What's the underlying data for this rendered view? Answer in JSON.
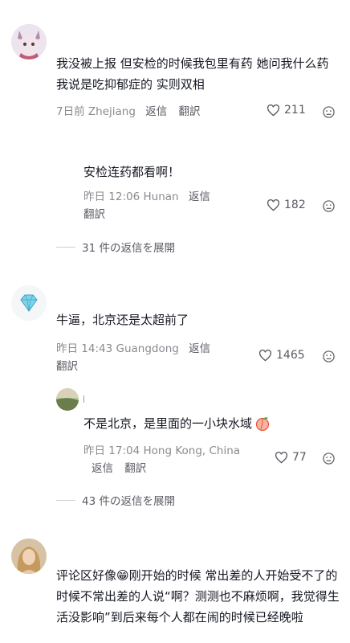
{
  "comments": [
    {
      "text": "我没被上报 但安检的时候我包里有药 她问我什么药 我说是吃抑郁症的 实则双相",
      "time": "7日前",
      "location": "Zhejiang",
      "reply_label": "返信",
      "translate_label": "翻訳",
      "likes": "211",
      "replies": [
        {
          "text": "安检连药都看啊！",
          "time": "昨日 12:06",
          "location": "Hunan",
          "reply_label": "返信",
          "translate_label": "翻訳",
          "likes": "182"
        }
      ],
      "expand_label": "31 件の返信を展開"
    },
    {
      "text": "牛逼，北京还是太超前了",
      "time": "昨日 14:43",
      "location": "Guangdong",
      "reply_label": "返信",
      "translate_label": "翻訳",
      "likes": "1465",
      "replies": [
        {
          "text": "不是北京，是里面的一小块水域",
          "time": "昨日 17:04",
          "location": "Hong Kong, China",
          "reply_label": "返信",
          "translate_label": "翻訳",
          "likes": "77"
        }
      ],
      "expand_label": "43 件の返信を展開"
    },
    {
      "text": "评论区好像😁刚开始的时候 常出差的人开始受不了的时候不常出差的人说“啊？测测也不麻烦啊，我觉得生活没影响”到后来每个人都在闹的时候已经晚啦"
    }
  ],
  "icons": {
    "like": "heart-outline-icon",
    "dislike": "sad-face-icon",
    "peach_emoji": "peach-emoji"
  }
}
